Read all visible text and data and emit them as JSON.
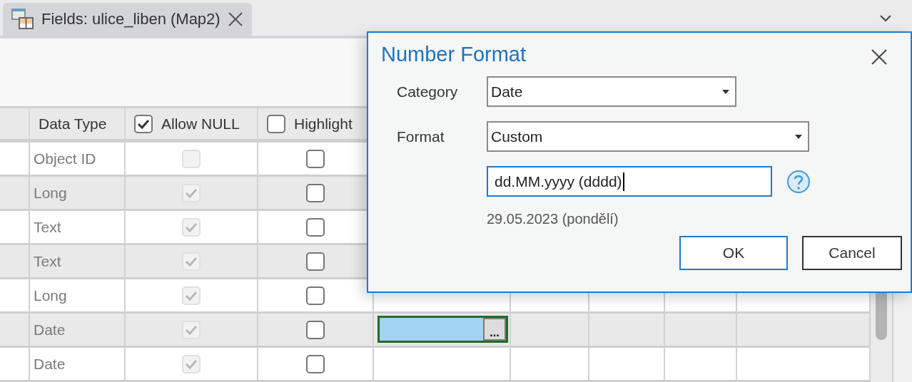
{
  "tab": {
    "title": "Fields: ulice_liben (Map2)",
    "selected": true
  },
  "table": {
    "columns": [
      {
        "label": "Data Type",
        "kind": "text"
      },
      {
        "label": "Allow NULL",
        "kind": "checkbox",
        "checked": true
      },
      {
        "label": "Highlight",
        "kind": "checkbox",
        "checked": false
      }
    ],
    "rows": [
      {
        "data_type": "Object ID",
        "allow_null": false,
        "allow_null_disabled": true,
        "highlight": false
      },
      {
        "data_type": "Long",
        "allow_null": true,
        "allow_null_disabled": true,
        "highlight": false
      },
      {
        "data_type": "Text",
        "allow_null": true,
        "allow_null_disabled": true,
        "highlight": false
      },
      {
        "data_type": "Text",
        "allow_null": true,
        "allow_null_disabled": true,
        "highlight": false
      },
      {
        "data_type": "Long",
        "allow_null": true,
        "allow_null_disabled": true,
        "highlight": false
      },
      {
        "data_type": "Date",
        "allow_null": true,
        "allow_null_disabled": true,
        "highlight": false,
        "format_editor": {
          "button": "..."
        }
      },
      {
        "data_type": "Date",
        "allow_null": true,
        "allow_null_disabled": true,
        "highlight": false
      }
    ]
  },
  "dialog": {
    "title": "Number Format",
    "category": {
      "label": "Category",
      "value": "Date"
    },
    "format": {
      "label": "Format",
      "value": "Custom"
    },
    "custom_format": {
      "value": "dd.MM.yyyy (dddd)"
    },
    "preview": "29.05.2023 (pondělí)",
    "buttons": [
      {
        "label": "OK",
        "default": true
      },
      {
        "label": "Cancel",
        "default": false
      }
    ]
  }
}
